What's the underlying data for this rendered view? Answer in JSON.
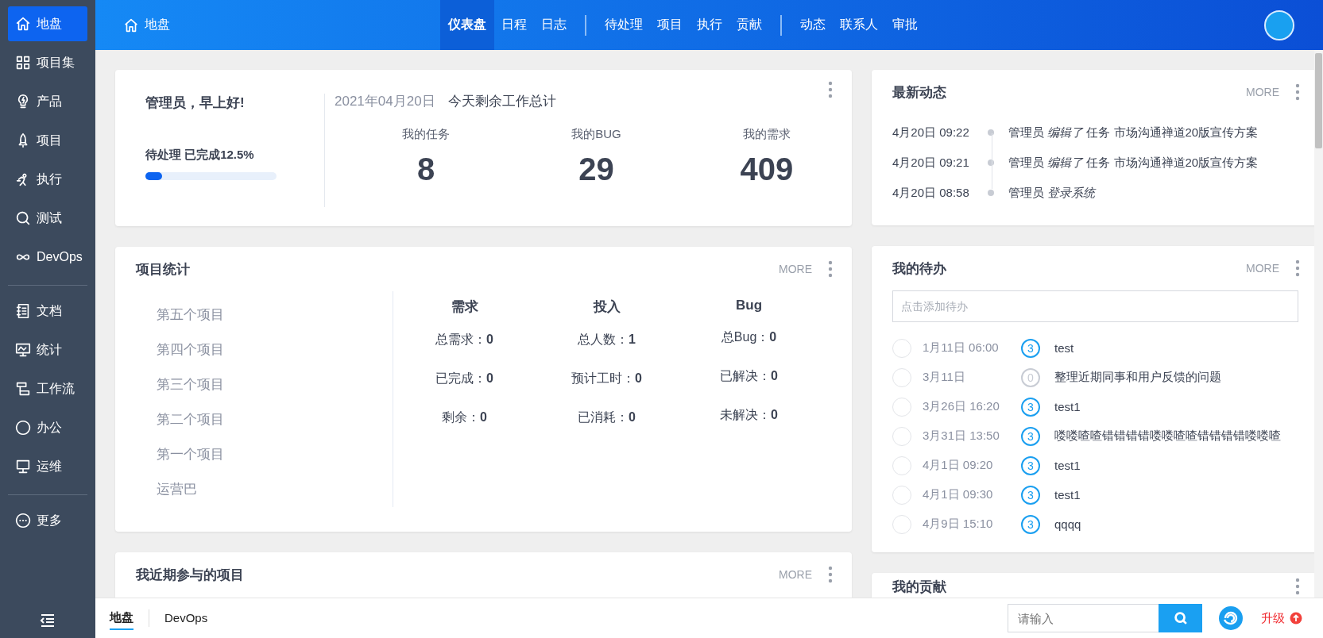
{
  "sidebar": {
    "groups": [
      [
        {
          "label": "地盘",
          "selected": true
        },
        {
          "label": "项目集",
          "selected": false
        },
        {
          "label": "产品",
          "selected": false
        },
        {
          "label": "项目",
          "selected": false
        },
        {
          "label": "执行",
          "selected": false
        },
        {
          "label": "测试",
          "selected": false
        },
        {
          "label": "DevOps",
          "selected": false
        }
      ],
      [
        {
          "label": "文档",
          "selected": false
        },
        {
          "label": "统计",
          "selected": false
        },
        {
          "label": "工作流",
          "selected": false
        },
        {
          "label": "办公",
          "selected": false
        },
        {
          "label": "运维",
          "selected": false
        }
      ],
      [
        {
          "label": "更多",
          "selected": false
        }
      ]
    ]
  },
  "header": {
    "title": "地盘",
    "nav": [
      [
        {
          "label": "仪表盘",
          "selected": true
        },
        {
          "label": "日程",
          "selected": false
        },
        {
          "label": "日志",
          "selected": false
        }
      ],
      [
        {
          "label": "待处理",
          "selected": false
        },
        {
          "label": "项目",
          "selected": false
        },
        {
          "label": "执行",
          "selected": false
        },
        {
          "label": "贡献",
          "selected": false
        }
      ],
      [
        {
          "label": "动态",
          "selected": false
        },
        {
          "label": "联系人",
          "selected": false
        },
        {
          "label": "审批",
          "selected": false
        }
      ]
    ]
  },
  "welcome": {
    "greeting": "管理员，早上好!",
    "date": "2021年04月20日",
    "summary_title": "今天剩余工作总计",
    "progress_label": "待处理 已完成12.5%",
    "level": 0.125,
    "stats": [
      {
        "label": "我的任务",
        "value": "8"
      },
      {
        "label": "我的BUG",
        "value": "29"
      },
      {
        "label": "我的需求",
        "value": "409"
      }
    ]
  },
  "project_stats": {
    "title": "项目统计",
    "more": "MORE",
    "projects": [
      "第五个项目",
      "第四个项目",
      "第三个项目",
      "第二个项目",
      "第一个项目",
      "运营巴"
    ],
    "columns": [
      {
        "heading": "需求",
        "rows": [
          {
            "label": "总需求：",
            "value": "0"
          },
          {
            "label": "已完成：",
            "value": "0"
          },
          {
            "label": "剩余：",
            "value": "0"
          }
        ]
      },
      {
        "heading": "投入",
        "rows": [
          {
            "label": "总人数：",
            "value": "1"
          },
          {
            "label": "预计工时：",
            "value": "0"
          },
          {
            "label": "已消耗：",
            "value": "0"
          }
        ]
      },
      {
        "heading": "Bug",
        "rows": [
          {
            "label": "总Bug：",
            "value": "0"
          },
          {
            "label": "已解决：",
            "value": "0"
          },
          {
            "label": "未解决：",
            "value": "0"
          }
        ]
      }
    ]
  },
  "recent_projects": {
    "title": "我近期参与的项目",
    "more": "MORE"
  },
  "activity": {
    "title": "最新动态",
    "more": "MORE",
    "items": [
      {
        "time": "4月20日 09:22",
        "text": "管理员 *编辑了* 任务 市场沟通禅道20版宣传方案"
      },
      {
        "time": "4月20日 09:21",
        "text": "管理员 *编辑了* 任务 市场沟通禅道20版宣传方案"
      },
      {
        "time": "4月20日 08:58",
        "text": "管理员 *登录系统*"
      }
    ]
  },
  "todos": {
    "title": "我的待办",
    "more": "MORE",
    "placeholder": "点击添加待办",
    "items": [
      {
        "checked": false,
        "date": "1月11日 06:00",
        "priority": "3",
        "color": "#1a9ff0",
        "name": "test"
      },
      {
        "checked": false,
        "date": "3月11日",
        "priority": "0",
        "color": "#c8ccd4",
        "name": "整理近期同事和用户反馈的问题"
      },
      {
        "checked": false,
        "date": "3月26日 16:20",
        "priority": "3",
        "color": "#1a9ff0",
        "name": "test1"
      },
      {
        "checked": false,
        "date": "3月31日 13:50",
        "priority": "3",
        "color": "#1a9ff0",
        "name": "喽喽喳喳错错错错喽喽喳喳错错错错喽喽喳"
      },
      {
        "checked": false,
        "date": "4月1日 09:20",
        "priority": "3",
        "color": "#1a9ff0",
        "name": "test1"
      },
      {
        "checked": false,
        "date": "4月1日 09:30",
        "priority": "3",
        "color": "#1a9ff0",
        "name": "test1"
      },
      {
        "checked": false,
        "date": "4月9日 15:10",
        "priority": "3",
        "color": "#1a9ff0",
        "name": "qqqq"
      }
    ]
  },
  "contribution": {
    "title": "我的贡献"
  },
  "footer": {
    "tabs": [
      {
        "label": "地盘",
        "selected": true
      },
      {
        "label": "DevOps",
        "selected": false
      }
    ],
    "search_placeholder": "请输入",
    "upgrade": "升级"
  }
}
